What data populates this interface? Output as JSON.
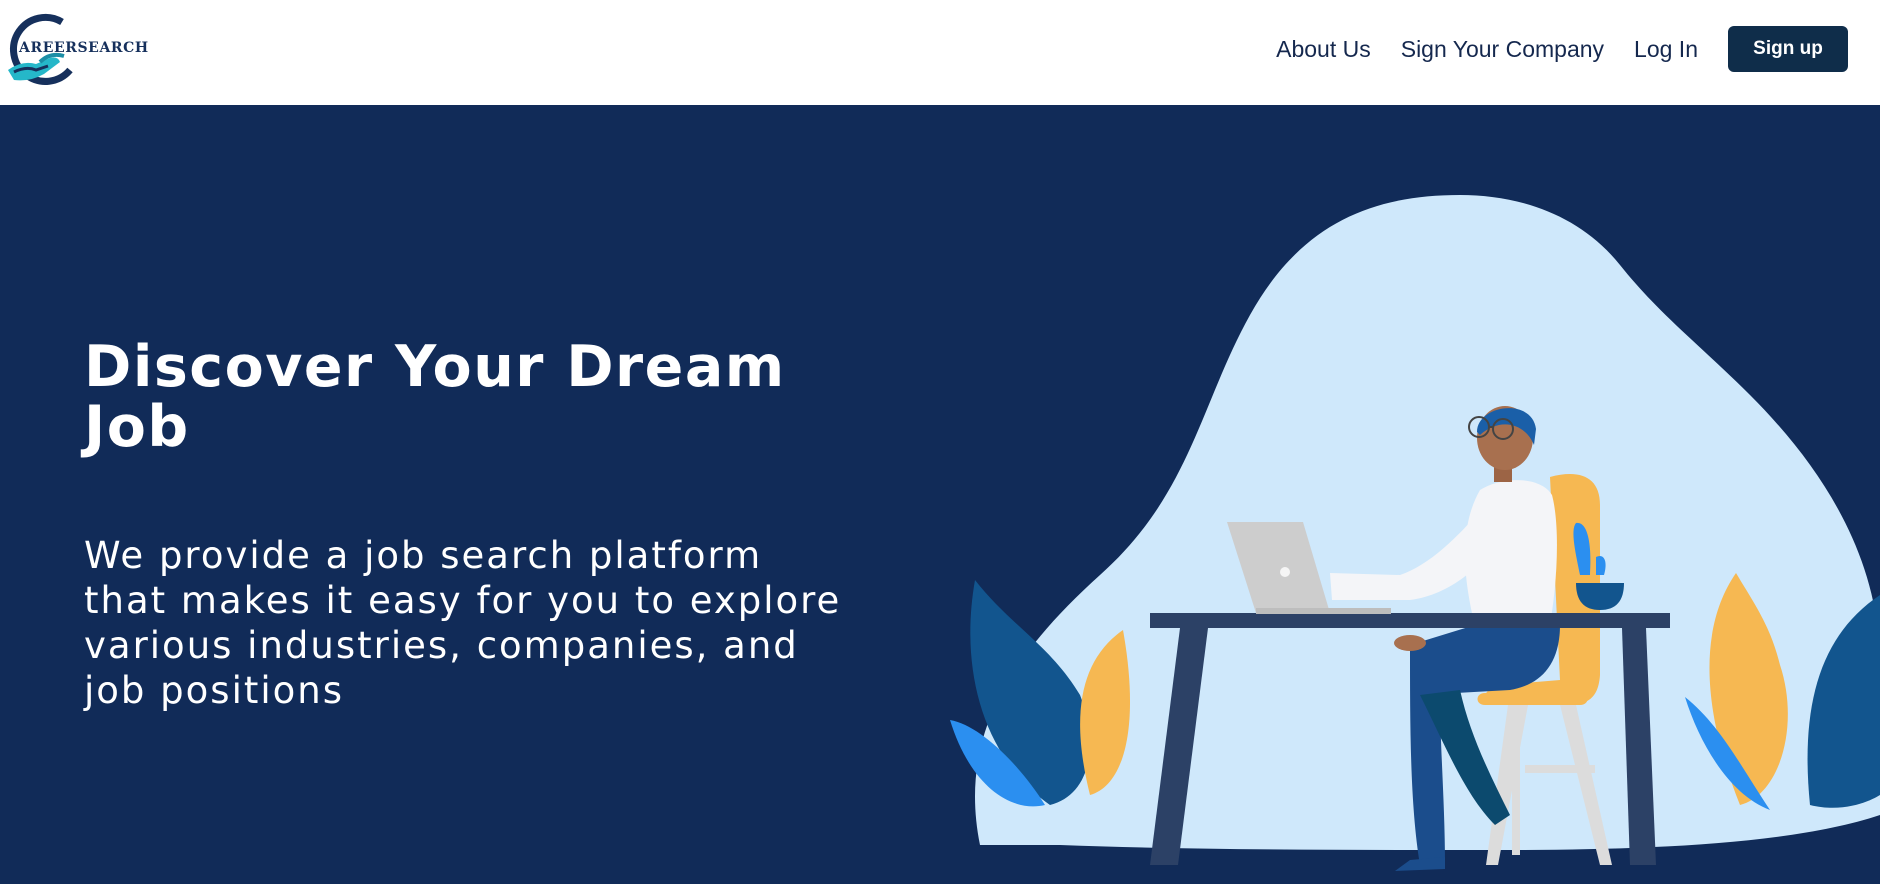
{
  "header": {
    "logo_text": "AREERSEARCH",
    "nav": {
      "about": "About Us",
      "sign_company": "Sign Your Company",
      "login": "Log In",
      "signup": "Sign up"
    }
  },
  "hero": {
    "title": "Discover Your Dream Job",
    "subtitle": "We provide a job search platform that makes it easy for you to explore various industries, companies, and job positions"
  },
  "colors": {
    "hero_background": "#112b58",
    "signup_button": "#0f2d4a",
    "blob": "#cfe8fb",
    "nav_text": "#15284e"
  },
  "icons": {
    "logo": "handshake-c-logo-icon",
    "illustration": "man-working-at-laptop-illustration"
  }
}
